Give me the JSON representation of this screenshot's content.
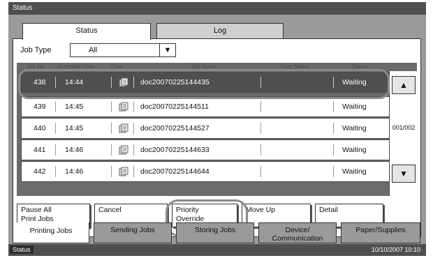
{
  "window": {
    "title": "Status"
  },
  "tabs": {
    "status": "Status",
    "log": "Log"
  },
  "job_type": {
    "label": "Job Type",
    "value": "All"
  },
  "columns": [
    "Job No.",
    "Accepted Time",
    "Type",
    "Job Name",
    "User Name",
    "Status"
  ],
  "jobs": [
    {
      "no": "438",
      "time": "14:44",
      "name": "doc20070225144435",
      "user": "",
      "status": "Waiting"
    },
    {
      "no": "439",
      "time": "14:45",
      "name": "doc20070225144511",
      "user": "",
      "status": "Waiting"
    },
    {
      "no": "440",
      "time": "14:45",
      "name": "doc20070225144527",
      "user": "",
      "status": "Waiting"
    },
    {
      "no": "441",
      "time": "14:46",
      "name": "doc20070225144633",
      "user": "",
      "status": "Waiting"
    },
    {
      "no": "442",
      "time": "14:46",
      "name": "doc20070225144644",
      "user": "",
      "status": "Waiting"
    }
  ],
  "pagination": {
    "indicator": "001/002"
  },
  "icons": {
    "up": "triangle-up-icon",
    "down": "triangle-down-icon",
    "document": "document-icon",
    "dropdown": "chevron-down-icon"
  },
  "actions": {
    "pause_all_line1": "Pause All",
    "pause_all_line2": "Print Jobs",
    "cancel": "Cancel",
    "priority_line1": "Priority",
    "priority_line2": "Override",
    "move_up": "Move Up",
    "detail": "Detail"
  },
  "bottom_tabs": {
    "printing": "Printing Jobs",
    "sending": "Sending Jobs",
    "storing": "Storing Jobs",
    "device_line1": "Device/",
    "device_line2": "Communication",
    "paper": "Paper/Supplies"
  },
  "status_bar": {
    "label": "Status",
    "datetime": "10/10/2007  10:10"
  }
}
